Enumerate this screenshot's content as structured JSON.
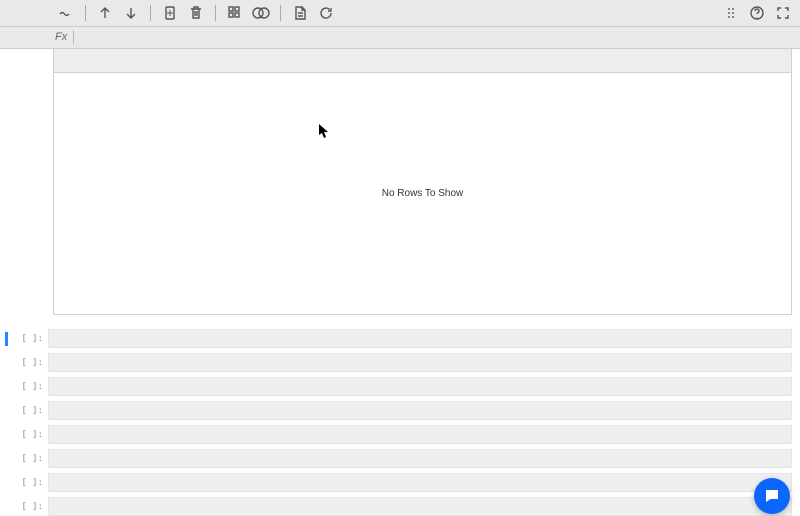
{
  "toolbar": {
    "tilde_icon": "tilde-icon",
    "up_icon": "arrow-up-icon",
    "down_icon": "arrow-down-icon",
    "copy_icon": "copy-icon",
    "delete_icon": "trash-icon",
    "apps_icon": "grid-icon",
    "overlap_icon": "overlap-circles-icon",
    "note_icon": "note-icon",
    "refresh_icon": "refresh-icon",
    "drag_icon": "drag-handle-icon",
    "help_icon": "help-icon",
    "expand_icon": "expand-icon"
  },
  "fx": {
    "label": "Fx",
    "value": ""
  },
  "grid": {
    "empty_message": "No Rows To Show"
  },
  "cells": [
    {
      "label": "[ ]:",
      "value": "",
      "active": true
    },
    {
      "label": "[ ]:",
      "value": "",
      "active": false
    },
    {
      "label": "[ ]:",
      "value": "",
      "active": false
    },
    {
      "label": "[ ]:",
      "value": "",
      "active": false
    },
    {
      "label": "[ ]:",
      "value": "",
      "active": false
    },
    {
      "label": "[ ]:",
      "value": "",
      "active": false
    },
    {
      "label": "[ ]:",
      "value": "",
      "active": false
    },
    {
      "label": "[ ]:",
      "value": "",
      "active": false
    }
  ],
  "chat": {
    "icon": "chat-icon"
  }
}
